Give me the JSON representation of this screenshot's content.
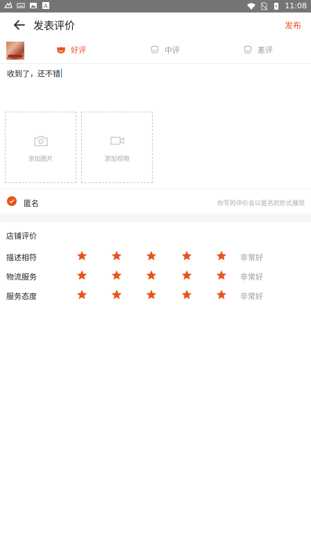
{
  "status_bar": {
    "time": "11:08"
  },
  "app_bar": {
    "title": "发表评价",
    "publish_label": "发布"
  },
  "rating_options": {
    "good": "好评",
    "medium": "中评",
    "bad": "差评",
    "selected": "good"
  },
  "comment": {
    "text": "收到了，还不错"
  },
  "upload": {
    "photo_label": "添加图片",
    "video_label": "添加视频"
  },
  "anonymous": {
    "label": "匿名",
    "checked": true,
    "hint": "你写的评价会以匿名的形式展现"
  },
  "shop_rating": {
    "title": "店铺评价",
    "rows": [
      {
        "label": "描述相符",
        "stars": 5,
        "text": "非常好"
      },
      {
        "label": "物流服务",
        "stars": 5,
        "text": "非常好"
      },
      {
        "label": "服务态度",
        "stars": 5,
        "text": "非常好"
      }
    ]
  },
  "colors": {
    "accent": "#e8551b",
    "status_bar": "#757575",
    "muted_text": "#999999"
  }
}
